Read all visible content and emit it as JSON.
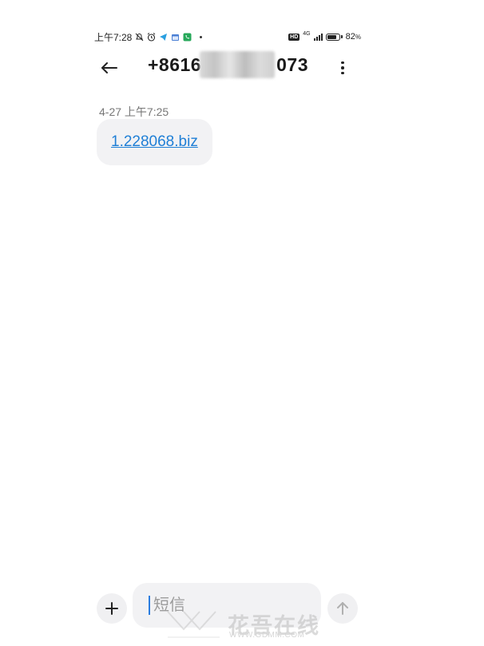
{
  "status_bar": {
    "time": "上午7:28",
    "network": "4G",
    "hd_badge": "HD",
    "battery_percent": 82,
    "battery_text": "82",
    "battery_unit": "%"
  },
  "header": {
    "back_icon": "arrow-left-icon",
    "phone_prefix": "+8616",
    "phone_suffix": "073",
    "more_icon": "more-vertical-icon"
  },
  "messages": [
    {
      "timestamp": "4-27 上午7:25",
      "text": "1.228068.biz"
    }
  ],
  "compose": {
    "placeholder": "短信",
    "add_icon": "plus-icon",
    "send_icon": "arrow-up-icon"
  },
  "watermark": {
    "text": "花吾在线",
    "url": "WWW.GDMM.COM"
  },
  "colors": {
    "link": "#1f7fd6",
    "bubble": "#f2f2f4",
    "caret": "#2b7de0"
  }
}
